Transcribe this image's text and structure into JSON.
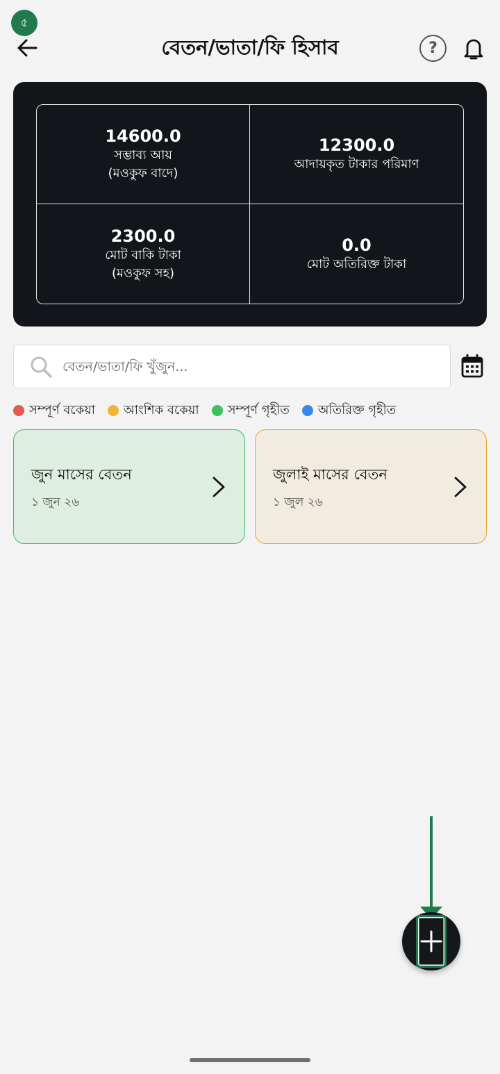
{
  "step_badge": "৫",
  "header": {
    "title": "বেতন/ভাতা/ফি হিসাব",
    "help_label": "?"
  },
  "summary": {
    "cells": [
      {
        "value": "14600.0",
        "label_line1": "সম্ভাব্য আয়",
        "label_line2": "(মওকুফ বাদে)"
      },
      {
        "value": "12300.0",
        "label_line1": "আদায়কৃত টাকার পরিমাণ",
        "label_line2": ""
      },
      {
        "value": "2300.0",
        "label_line1": "মোট বাকি টাকা",
        "label_line2": "(মওকুফ সহ)"
      },
      {
        "value": "0.0",
        "label_line1": "মোট অতিরিক্ত টাকা",
        "label_line2": ""
      }
    ]
  },
  "search": {
    "placeholder": "বেতন/ভাতা/ফি খুঁজুন..."
  },
  "legend": [
    {
      "label": "সম্পূর্ণ বকেয়া",
      "color": "#e05a4f"
    },
    {
      "label": "আংশিক বকেয়া",
      "color": "#f0b43a"
    },
    {
      "label": "সম্পূর্ণ গৃহীত",
      "color": "#3cc060"
    },
    {
      "label": "অতিরিক্ত গৃহীত",
      "color": "#3a86e8"
    }
  ],
  "months": [
    {
      "title": "জুন মাসের বেতন",
      "date": "১ জুন ২৬",
      "status_color": "#3cc060"
    },
    {
      "title": "জুলাই মাসের বেতন",
      "date": "১ জুল ২৬",
      "status_color": "#e8a82a"
    }
  ],
  "fab": {
    "icon": "plus-icon"
  },
  "colors": {
    "accent_green": "#1f7a4d",
    "summary_bg": "#121519",
    "page_bg": "#f3f3f3"
  }
}
